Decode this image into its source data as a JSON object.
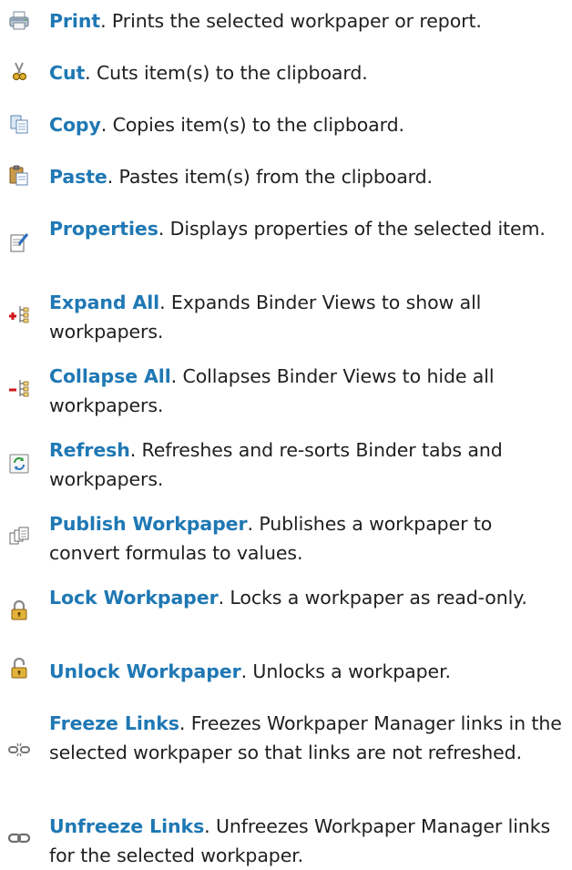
{
  "items": [
    {
      "term": "Print",
      "desc": ". Prints the selected workpaper or report.",
      "icon": "printer-icon"
    },
    {
      "term": "Cut",
      "desc": ". Cuts item(s) to the clipboard.",
      "icon": "scissors-icon"
    },
    {
      "term": "Copy",
      "desc": ". Copies item(s) to the clipboard.",
      "icon": "copy-icon"
    },
    {
      "term": "Paste",
      "desc": ". Pastes item(s) from the clipboard.",
      "icon": "clipboard-paste-icon"
    },
    {
      "term": "Properties",
      "desc": ". Displays properties of the selected item.",
      "icon": "properties-icon"
    },
    {
      "term": "Expand All",
      "desc": ". Expands Binder Views to show all workpapers.",
      "icon": "expand-tree-icon"
    },
    {
      "term": "Collapse All",
      "desc": ". Collapses Binder Views to hide all workpapers.",
      "icon": "collapse-tree-icon"
    },
    {
      "term": "Refresh",
      "desc": ". Refreshes and re-sorts Binder tabs and workpapers.",
      "icon": "refresh-icon"
    },
    {
      "term": "Publish Workpaper",
      "desc": ". Publishes a workpaper to convert formulas to values.",
      "icon": "publish-icon"
    },
    {
      "term": "Lock Workpaper",
      "desc": ". Locks a workpaper as read-only.",
      "icon": "lock-icon"
    },
    {
      "term": "Unlock Workpaper",
      "desc": ". Unlocks a workpaper.",
      "icon": "unlock-icon"
    },
    {
      "term": "Freeze Links",
      "desc": ". Freezes Workpaper Manager links in the selected workpaper so that links are not refreshed.",
      "icon": "broken-link-icon"
    },
    {
      "term": "Unfreeze Links",
      "desc": ". Unfreezes Workpaper Manager links for the selected workpaper.",
      "icon": "chain-link-icon"
    }
  ]
}
